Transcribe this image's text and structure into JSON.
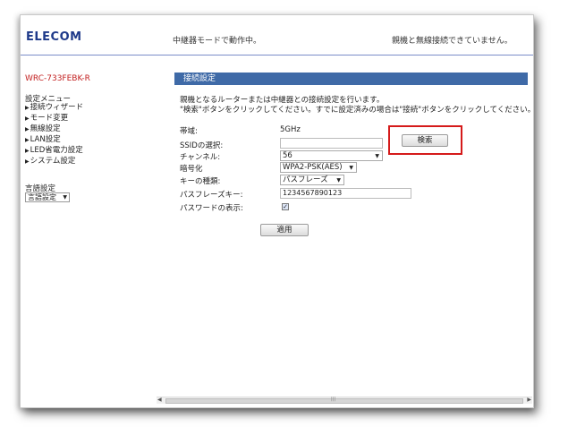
{
  "header": {
    "logo": "ELECOM",
    "mode_text": "中継器モードで動作中。",
    "connection_status": "親機と無線接続できていません。"
  },
  "sidebar": {
    "model": "WRC-733FEBK-R",
    "menu_title": "設定メニュー",
    "items": [
      {
        "label": "接続ウィザード"
      },
      {
        "label": "モード変更"
      },
      {
        "label": "無線設定"
      },
      {
        "label": "LAN設定"
      },
      {
        "label": "LED省電力設定"
      },
      {
        "label": "システム設定"
      }
    ],
    "language_label": "言語設定",
    "language_select_value": "言語設定"
  },
  "main": {
    "section_title": "接続設定",
    "description_line1": "親機となるルーターまたは中継器との接続設定を行います。",
    "description_line2": "\"検索\"ボタンをクリックしてください。すでに設定済みの場合は\"接続\"ボタンをクリックしてください。",
    "band_label": "帯域:",
    "band_value": "5GHz",
    "ssid_label": "SSIDの選択:",
    "ssid_value": "",
    "search_button": "検索",
    "channel_label": "チャンネル:",
    "channel_value": "56",
    "encryption_label": "暗号化",
    "encryption_value": "WPA2-PSK(AES)",
    "key_type_label": "キーの種類:",
    "key_type_value": "パスフレーズ",
    "passphrase_label": "パスフレーズキー:",
    "passphrase_value": "1234567890123",
    "show_password_label": "パスワードの表示:",
    "show_password_checked": true,
    "apply_button": "適用"
  },
  "colors": {
    "logo": "#1f3a8a",
    "model_text": "#c21f1f",
    "section_bar": "#3f6aa7",
    "highlight_box": "#d51a1a"
  }
}
